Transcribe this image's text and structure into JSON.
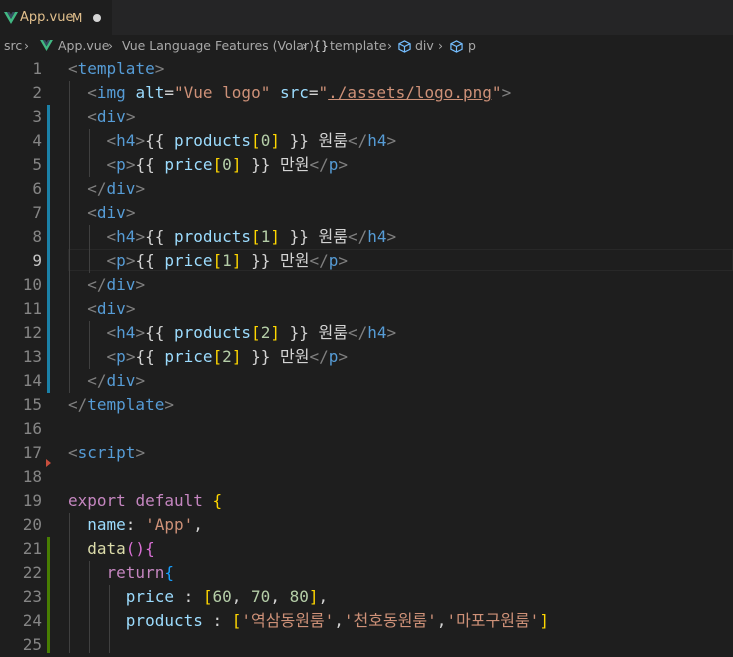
{
  "tab": {
    "file_name": "App.vue",
    "status": "M"
  },
  "breadcrumb": [
    "src",
    "App.vue",
    "Vue Language Features (Volar)",
    "template",
    "div",
    "p"
  ],
  "editor": {
    "active_line": "9",
    "line_numbers": [
      "1",
      "2",
      "3",
      "4",
      "5",
      "6",
      "7",
      "8",
      "9",
      "10",
      "11",
      "12",
      "13",
      "14",
      "15",
      "16",
      "17",
      "18",
      "19",
      "20",
      "21",
      "22",
      "23",
      "24",
      "25"
    ]
  },
  "code": {
    "l1": {
      "open": "<",
      "tag": "template",
      "close": ">"
    },
    "l2": {
      "open": "<",
      "tag": "img",
      "attr1": "alt",
      "eq1": "=",
      "val1": "\"Vue logo\"",
      "attr2": "src",
      "eq2": "=",
      "q_open": "\"",
      "val2": "./assets/logo.png",
      "q_close": "\"",
      "close": ">"
    },
    "l3": {
      "open": "<",
      "tag": "div",
      "close": ">"
    },
    "l4": {
      "open": "<",
      "tag": "h4",
      "close": ">",
      "mopen": "{{ ",
      "var": "products",
      "bopen": "[",
      "idx": "0",
      "bclose": "]",
      "mclose": " }}",
      "text": " 원룸",
      "end_open": "</",
      "end_tag": "h4",
      "end_close": ">"
    },
    "l5": {
      "open": "<",
      "tag": "p",
      "close": ">",
      "mopen": "{{ ",
      "var": "price",
      "bopen": "[",
      "idx": "0",
      "bclose": "]",
      "mclose": " }}",
      "text": " 만원",
      "end_open": "</",
      "end_tag": "p",
      "end_close": ">"
    },
    "l6": {
      "open": "</",
      "tag": "div",
      "close": ">"
    },
    "l7": {
      "open": "<",
      "tag": "div",
      "close": ">"
    },
    "l8": {
      "open": "<",
      "tag": "h4",
      "close": ">",
      "mopen": "{{ ",
      "var": "products",
      "bopen": "[",
      "idx": "1",
      "bclose": "]",
      "mclose": " }}",
      "text": " 원룸",
      "end_open": "</",
      "end_tag": "h4",
      "end_close": ">"
    },
    "l9": {
      "open": "<",
      "tag": "p",
      "close": ">",
      "mopen": "{{ ",
      "var": "price",
      "bopen": "[",
      "idx": "1",
      "bclose": "]",
      "mclose": " }}",
      "text": " 만원",
      "end_open": "</",
      "end_tag": "p",
      "end_close": ">"
    },
    "l10": {
      "open": "</",
      "tag": "div",
      "close": ">"
    },
    "l11": {
      "open": "<",
      "tag": "div",
      "close": ">"
    },
    "l12": {
      "open": "<",
      "tag": "h4",
      "close": ">",
      "mopen": "{{ ",
      "var": "products",
      "bopen": "[",
      "idx": "2",
      "bclose": "]",
      "mclose": " }}",
      "text": " 원룸",
      "end_open": "</",
      "end_tag": "h4",
      "end_close": ">"
    },
    "l13": {
      "open": "<",
      "tag": "p",
      "close": ">",
      "mopen": "{{ ",
      "var": "price",
      "bopen": "[",
      "idx": "2",
      "bclose": "]",
      "mclose": " }}",
      "text": " 만원",
      "end_open": "</",
      "end_tag": "p",
      "end_close": ">"
    },
    "l14": {
      "open": "</",
      "tag": "div",
      "close": ">"
    },
    "l15": {
      "open": "</",
      "tag": "template",
      "close": ">"
    },
    "l17": {
      "open": "<",
      "tag": "script",
      "close": ">"
    },
    "l19": {
      "kw1": "export",
      "kw2": "default",
      "brace": "{"
    },
    "l20": {
      "key": "name",
      "colon": ": ",
      "val": "'App'",
      "comma": ","
    },
    "l21": {
      "name": "data",
      "parens": "()",
      "brace": "{"
    },
    "l22": {
      "kw": "return",
      "brace": "{"
    },
    "l23": {
      "key": "price",
      "colon": " : ",
      "bopen": "[",
      "n1": "60",
      "c1": ", ",
      "n2": "70",
      "c2": ", ",
      "n3": "80",
      "bclose": "]",
      "comma": ","
    },
    "l24": {
      "key": "products",
      "colon": " : ",
      "bopen": "[",
      "s1": "'역삼동원룸'",
      "c1": ",",
      "s2": "'천호동원룸'",
      "c2": ",",
      "s3": "'마포구원룸'",
      "bclose": "]"
    }
  },
  "colors": {
    "background": "#1e1e1e",
    "tab_modified": "#e2c08d",
    "keyword_control": "#c586c0",
    "tag": "#569cd6",
    "attribute": "#9cdcfe",
    "string": "#ce9178",
    "number": "#b5cea8",
    "gutter_modified": "#1b81a8",
    "gutter_added": "#487e02"
  }
}
